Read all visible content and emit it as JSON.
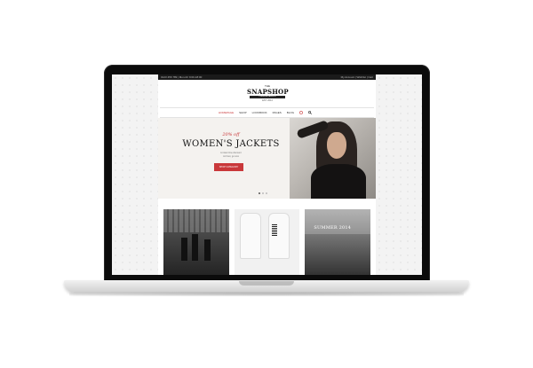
{
  "site": {
    "topbar": {
      "left_text": "0123 456 789 | Mon-Fri 9:00-18:00",
      "right_text": "My Account | Wishlist | Cart"
    },
    "logo": {
      "the": "THE",
      "name": "SNAPSHOP",
      "tagline": "PREMIUM FASHION",
      "est": "EST. 2014"
    },
    "nav": [
      "Homepage",
      "Shop",
      "Lookbook",
      "Pages",
      "Blog"
    ],
    "hero": {
      "discount": "20% off",
      "title": "WOMEN'S JACKETS",
      "line1": "Limited time discount",
      "line2": "Act fast, go now",
      "cta": "SHOP CATEGORY"
    },
    "cards": {
      "card3_title": "SUMMER 2014"
    }
  },
  "colors": {
    "accent": "#c9383a",
    "laptop_bezel": "#0b0b0b",
    "topbar": "#1a1a1a"
  }
}
